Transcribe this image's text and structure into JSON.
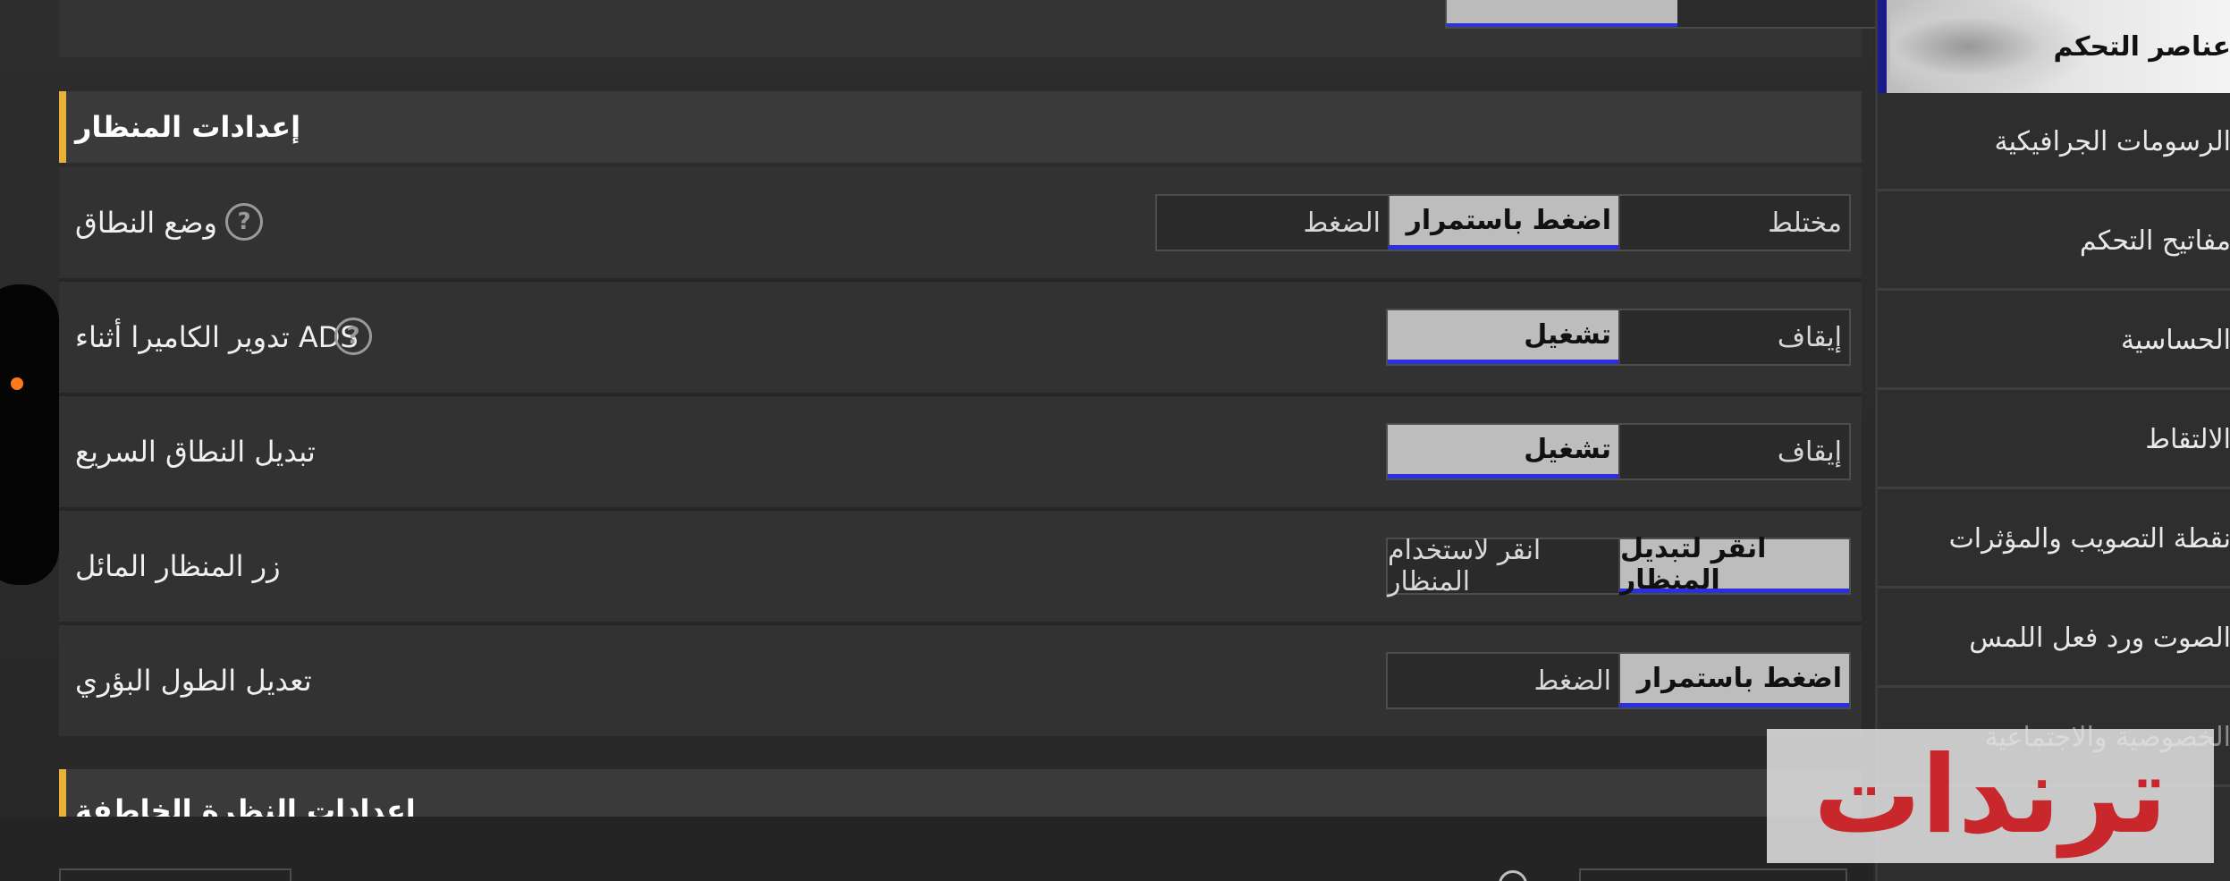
{
  "scope_section": {
    "header": "إعدادات المنظار",
    "rows": [
      {
        "label": "وضع النطاق",
        "has_help": true,
        "options": [
          "مختلط",
          "اضغط باستمرار",
          "الضغط"
        ],
        "selected": "اضغط باستمرار"
      },
      {
        "label": "تدوير الكاميرا أثناء ADS",
        "has_help": true,
        "options": [
          "إيقاف",
          "تشغيل"
        ],
        "selected": "تشغيل"
      },
      {
        "label": "تبديل النطاق السريع",
        "has_help": false,
        "options": [
          "إيقاف",
          "تشغيل"
        ],
        "selected": "تشغيل"
      },
      {
        "label": "زر المنظار المائل",
        "has_help": false,
        "options": [
          "انقر لتبديل المنظار",
          "انقر لاستخدام المنظار"
        ],
        "selected": "انقر لتبديل المنظار"
      },
      {
        "label": "تعديل الطول البؤري",
        "has_help": false,
        "options": [
          "اضغط باستمرار",
          "الضغط"
        ],
        "selected": "اضغط باستمرار"
      }
    ]
  },
  "peek_section": {
    "header": "إعدادات النظرة الخاطفة"
  },
  "help_glyph": "?",
  "sidebar": {
    "items": [
      {
        "label": "عناصر التحكم",
        "active": true
      },
      {
        "label": "الرسومات الجرافيكية"
      },
      {
        "label": "مفاتيح التحكم"
      },
      {
        "label": "الحساسية"
      },
      {
        "label": "الالتقاط"
      },
      {
        "label": "نقطة التصويب والمؤثرات"
      },
      {
        "label": "الصوت ورد فعل اللمس"
      },
      {
        "label": "الخصوصية والاجتماعية",
        "faded": true
      }
    ]
  },
  "watermark": {
    "text": "ترندات"
  },
  "colors": {
    "accent_yellow": "#e8b23a",
    "selected_bg": "#bdbdbd",
    "selected_underline": "#2b2fe0",
    "notification_dot": "#ff7a1a",
    "watermark_red": "#c8282c"
  }
}
